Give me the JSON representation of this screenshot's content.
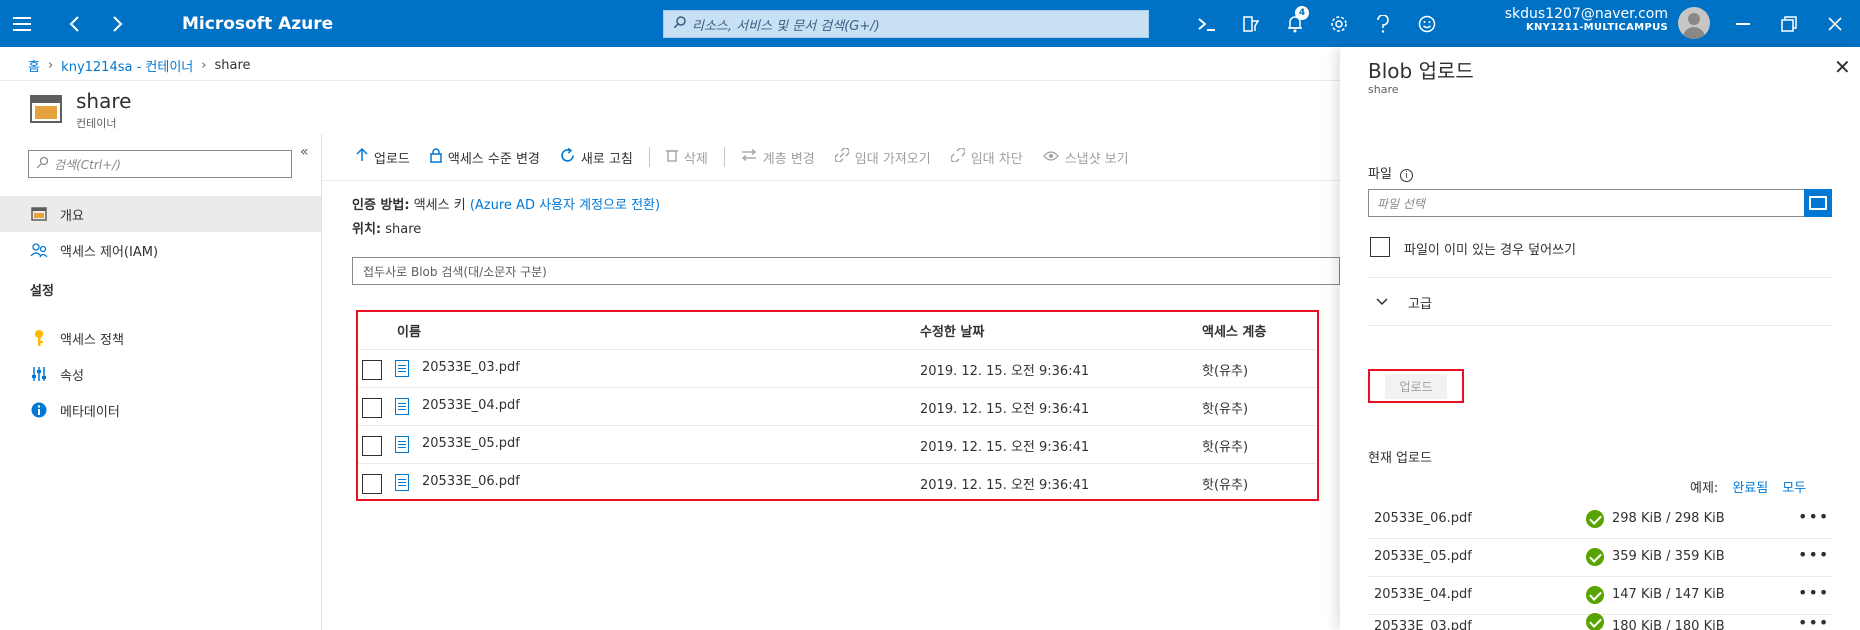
{
  "topbar": {
    "brand": "Microsoft Azure",
    "search_placeholder": "리소스, 서비스 및 문서 검색(G+/)",
    "notification_count": "4",
    "account_email": "skdus1207@naver.com",
    "account_directory": "KNY1211-MULTICAMPUS"
  },
  "breadcrumb": {
    "home": "홈",
    "account": "kny1214sa - 컨테이너",
    "current": "share"
  },
  "resource": {
    "title": "share",
    "subtitle": "컨테이너"
  },
  "leftnav": {
    "search_placeholder": "검색(Ctrl+/)",
    "items": [
      {
        "label": "개요"
      },
      {
        "label": "액세스 제어(IAM)"
      }
    ],
    "section_settings": "설정",
    "settings_items": [
      {
        "label": "액세스 정책"
      },
      {
        "label": "속성"
      },
      {
        "label": "메타데이터"
      }
    ]
  },
  "toolbar": {
    "upload": "업로드",
    "access_level": "액세스 수준 변경",
    "refresh": "새로 고침",
    "delete": "삭제",
    "change_tier": "계층 변경",
    "acquire_lease": "임대 가져오기",
    "break_lease": "임대 차단",
    "snapshot": "스냅샷 보기"
  },
  "main": {
    "auth_label": "인증 방법:",
    "auth_value": "액세스 키",
    "auth_link": "(Azure AD 사용자 계정으로 전환)",
    "loc_label": "위치:",
    "loc_value": "share",
    "blob_search_placeholder": "접두사로 Blob 검색(대/소문자 구분)"
  },
  "table": {
    "headers": {
      "name": "이름",
      "modified": "수정한 날짜",
      "tier": "액세스 계층"
    },
    "rows": [
      {
        "name": "20533E_03.pdf",
        "modified": "2019. 12. 15. 오전 9:36:41",
        "tier": "핫(유추)"
      },
      {
        "name": "20533E_04.pdf",
        "modified": "2019. 12. 15. 오전 9:36:41",
        "tier": "핫(유추)"
      },
      {
        "name": "20533E_05.pdf",
        "modified": "2019. 12. 15. 오전 9:36:41",
        "tier": "핫(유추)"
      },
      {
        "name": "20533E_06.pdf",
        "modified": "2019. 12. 15. 오전 9:36:41",
        "tier": "핫(유추)"
      }
    ]
  },
  "panel": {
    "title": "Blob 업로드",
    "subtitle": "share",
    "files_label": "파일",
    "file_placeholder": "파일 선택",
    "overwrite_label": "파일이 이미 있는 경우 덮어쓰기",
    "advanced_label": "고급",
    "upload_button": "업로드",
    "current_uploads": "현재 업로드",
    "filter_label": "예제:",
    "filter_complete": "완료됨",
    "filter_all": "모두",
    "uploads": [
      {
        "name": "20533E_06.pdf",
        "size": "298 KiB / 298 KiB"
      },
      {
        "name": "20533E_05.pdf",
        "size": "359 KiB / 359 KiB"
      },
      {
        "name": "20533E_04.pdf",
        "size": "147 KiB / 147 KiB"
      },
      {
        "name": "20533E_03.pdf",
        "size": "180 KiB / 180 KiB"
      }
    ]
  }
}
